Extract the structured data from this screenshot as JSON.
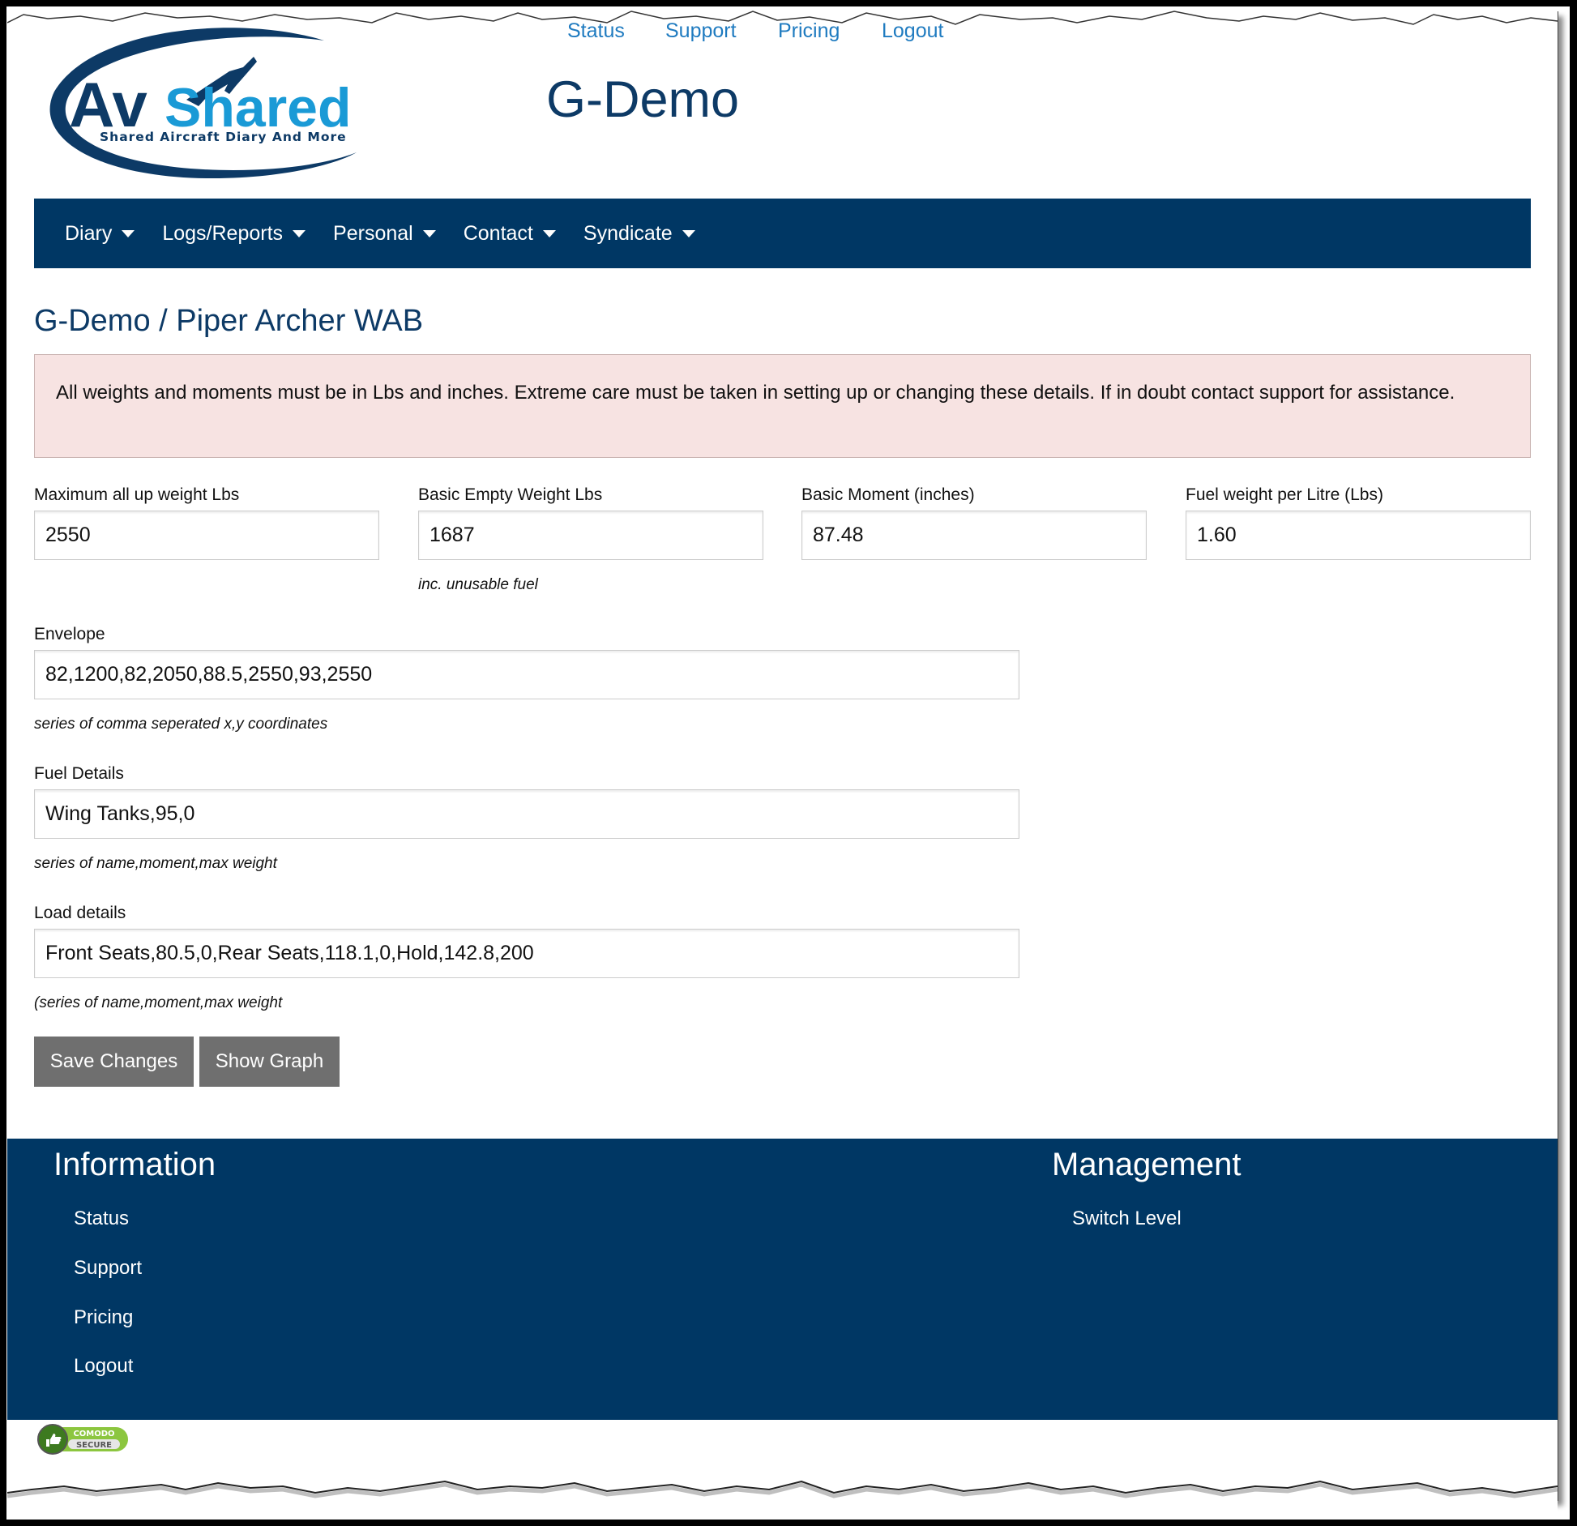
{
  "header": {
    "logo": {
      "brand_dark": "Av",
      "brand_light": "Shared",
      "tagline": "Shared Aircraft Diary And More"
    },
    "top_links": [
      "Status",
      "Support",
      "Pricing",
      "Logout"
    ],
    "site_title": "G-Demo"
  },
  "navbar": {
    "items": [
      {
        "label": "Diary",
        "icon": "caret-down-icon"
      },
      {
        "label": "Logs/Reports",
        "icon": "caret-down-icon"
      },
      {
        "label": "Personal",
        "icon": "caret-down-icon"
      },
      {
        "label": "Contact",
        "icon": "caret-down-icon"
      },
      {
        "label": "Syndicate",
        "icon": "caret-down-icon"
      }
    ]
  },
  "main": {
    "heading": "G-Demo / Piper Archer WAB",
    "alert": "All weights and moments must be in Lbs and inches. Extreme care must be taken in setting up or changing these details. If in doubt contact support for assistance.",
    "fields": {
      "max_weight": {
        "label": "Maximum all up weight Lbs",
        "value": "2550"
      },
      "empty_weight": {
        "label": "Basic Empty Weight Lbs",
        "value": "1687",
        "help": "inc. unusable fuel"
      },
      "basic_moment": {
        "label": "Basic Moment (inches)",
        "value": "87.48"
      },
      "fuel_weight": {
        "label": "Fuel weight per Litre (Lbs)",
        "value": "1.60"
      },
      "envelope": {
        "label": "Envelope",
        "value": "82,1200,82,2050,88.5,2550,93,2550",
        "help": "series of comma seperated x,y coordinates"
      },
      "fuel_details": {
        "label": "Fuel Details",
        "value": "Wing Tanks,95,0",
        "help": "series of name,moment,max weight"
      },
      "load_details": {
        "label": "Load details",
        "value": "Front Seats,80.5,0,Rear Seats,118.1,0,Hold,142.8,200",
        "help": "(series of name,moment,max weight"
      }
    },
    "buttons": {
      "save": "Save Changes",
      "graph": "Show Graph"
    }
  },
  "footer": {
    "information": {
      "heading": "Information",
      "links": [
        "Status",
        "Support",
        "Pricing",
        "Logout"
      ]
    },
    "management": {
      "heading": "Management",
      "links": [
        "Switch Level"
      ]
    },
    "badge": {
      "top": "COMODO",
      "bottom": "SECURE"
    }
  },
  "colors": {
    "brand_dark": "#003764",
    "brand_light": "#1a9ad6",
    "link": "#1f7bc0",
    "alert_bg": "#f7e3e2",
    "button_bg": "#6f6f6f"
  }
}
